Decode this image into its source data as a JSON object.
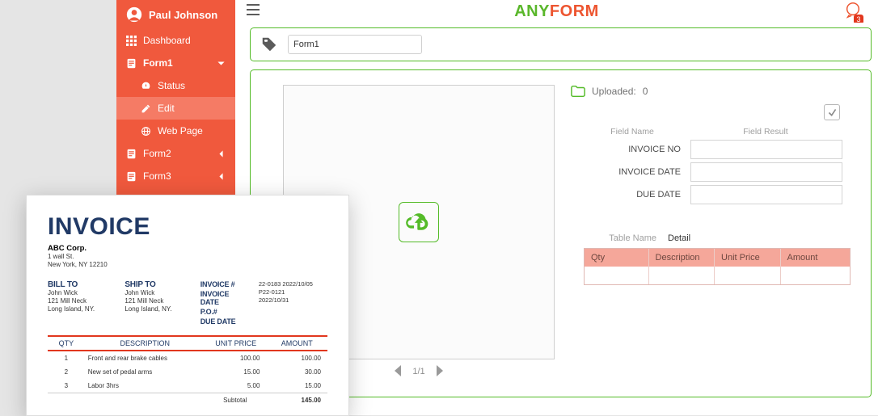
{
  "user": {
    "name": "Paul Johnson"
  },
  "sidebar": {
    "dashboard": "Dashboard",
    "form1": "Form1",
    "status": "Status",
    "edit": "Edit",
    "webpage": "Web Page",
    "form2": "Form2",
    "form3": "Form3"
  },
  "logo": {
    "prefix": "ANY",
    "suffix": "FORM"
  },
  "notifications": {
    "count": "3"
  },
  "tag": {
    "input_value": "Form1"
  },
  "preview": {
    "pager": {
      "current": "1",
      "total": "1",
      "display": "1/1"
    }
  },
  "uploaded": {
    "label": "Uploaded:",
    "count": "0"
  },
  "fields": {
    "header_name": "Field Name",
    "header_result": "Field Result",
    "rows": [
      {
        "label": "INVOICE NO",
        "value": ""
      },
      {
        "label": "INVOICE DATE",
        "value": ""
      },
      {
        "label": "DUE DATE",
        "value": ""
      }
    ]
  },
  "detail_table": {
    "name_label": "Table Name",
    "name_value": "Detail",
    "columns": [
      "Qty",
      "Description",
      "Unit Price",
      "Amount"
    ]
  },
  "invoice": {
    "title": "INVOICE",
    "company": "ABC Corp.",
    "addr1": "1 wall St.",
    "addr2": "New York, NY 12210",
    "billto_label": "BILL TO",
    "shipto_label": "SHIP TO",
    "bill": {
      "name": "John Wick",
      "addr1": "121 Mill Neck",
      "addr2": "Long Island, NY."
    },
    "ship": {
      "name": "John Wick",
      "addr1": "121 Mill Neck",
      "addr2": "Long Island, NY."
    },
    "meta_labels": {
      "inv_no": "INVOICE #",
      "inv_date": "INVOICE DATE",
      "po": "P.O.#",
      "due": "DUE DATE"
    },
    "meta_vals": {
      "inv_no": "22-0183 2022/10/05",
      "inv_date": "P22-0121",
      "due": "2022/10/31"
    },
    "cols": [
      "QTY",
      "DESCRIPTION",
      "UNIT PRICE",
      "AMOUNT"
    ],
    "lines": [
      {
        "qty": "1",
        "desc": "Front and rear brake cables",
        "up": "100.00",
        "amt": "100.00"
      },
      {
        "qty": "2",
        "desc": "New set of pedal arms",
        "up": "15.00",
        "amt": "30.00"
      },
      {
        "qty": "3",
        "desc": "Labor 3hrs",
        "up": "5.00",
        "amt": "15.00"
      }
    ],
    "subtotal_label": "Subtotal",
    "subtotal_value": "145.00"
  }
}
